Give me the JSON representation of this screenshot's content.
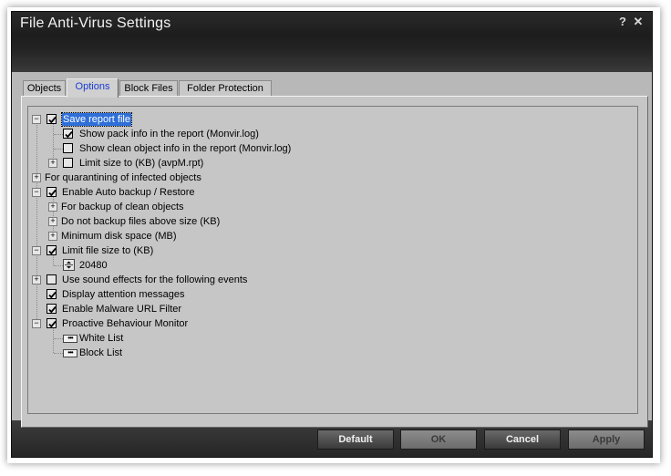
{
  "window": {
    "title": "File Anti-Virus Settings",
    "help_glyph": "?",
    "close_glyph": "✕"
  },
  "tabs": [
    {
      "label": "Objects",
      "active": false
    },
    {
      "label": "Options",
      "active": true
    },
    {
      "label": "Block Files",
      "active": false
    },
    {
      "label": "Folder Protection",
      "active": false
    }
  ],
  "tree": {
    "save_report": {
      "label": "Save report file",
      "checked": true,
      "expanded": true,
      "selected": true
    },
    "show_pack": {
      "label": "Show pack info in the report (Monvir.log)",
      "checked": true
    },
    "show_clean": {
      "label": "Show clean object info in the report (Monvir.log)",
      "checked": false
    },
    "limit_size": {
      "label": "Limit size to (KB) (avpM.rpt)",
      "checked": false,
      "expanded": false
    },
    "quarantine": {
      "label": "For quarantining of infected objects",
      "expanded": false
    },
    "auto_backup": {
      "label": "Enable Auto backup / Restore",
      "checked": true,
      "expanded": true
    },
    "backup_clean": {
      "label": "For backup of clean objects",
      "expanded": false
    },
    "no_backup_above": {
      "label": "Do not backup files above size (KB)",
      "expanded": false
    },
    "min_disk": {
      "label": "Minimum disk space (MB)",
      "expanded": false
    },
    "limit_file_size": {
      "label": "Limit file size to (KB)",
      "checked": true,
      "expanded": true
    },
    "file_size_value": {
      "value": "20480"
    },
    "sound_effects": {
      "label": "Use sound effects for the following events",
      "checked": false,
      "expanded": false
    },
    "attention": {
      "label": "Display attention messages",
      "checked": true
    },
    "malware_url": {
      "label": "Enable Malware URL Filter",
      "checked": true
    },
    "proactive": {
      "label": "Proactive Behaviour Monitor",
      "checked": true,
      "expanded": true
    },
    "white_list": {
      "label": "White List"
    },
    "block_list": {
      "label": "Block List"
    }
  },
  "buttons": {
    "default": {
      "label": "Default",
      "enabled": true
    },
    "ok": {
      "label": "OK",
      "enabled": false
    },
    "cancel": {
      "label": "Cancel",
      "enabled": true
    },
    "apply": {
      "label": "Apply",
      "enabled": false
    }
  },
  "icons": {
    "expand_collapse": "plus-minus-box-icon",
    "checkbox": "checkbox-icon",
    "list": "list-icon",
    "spinner": "spinner-icon"
  }
}
